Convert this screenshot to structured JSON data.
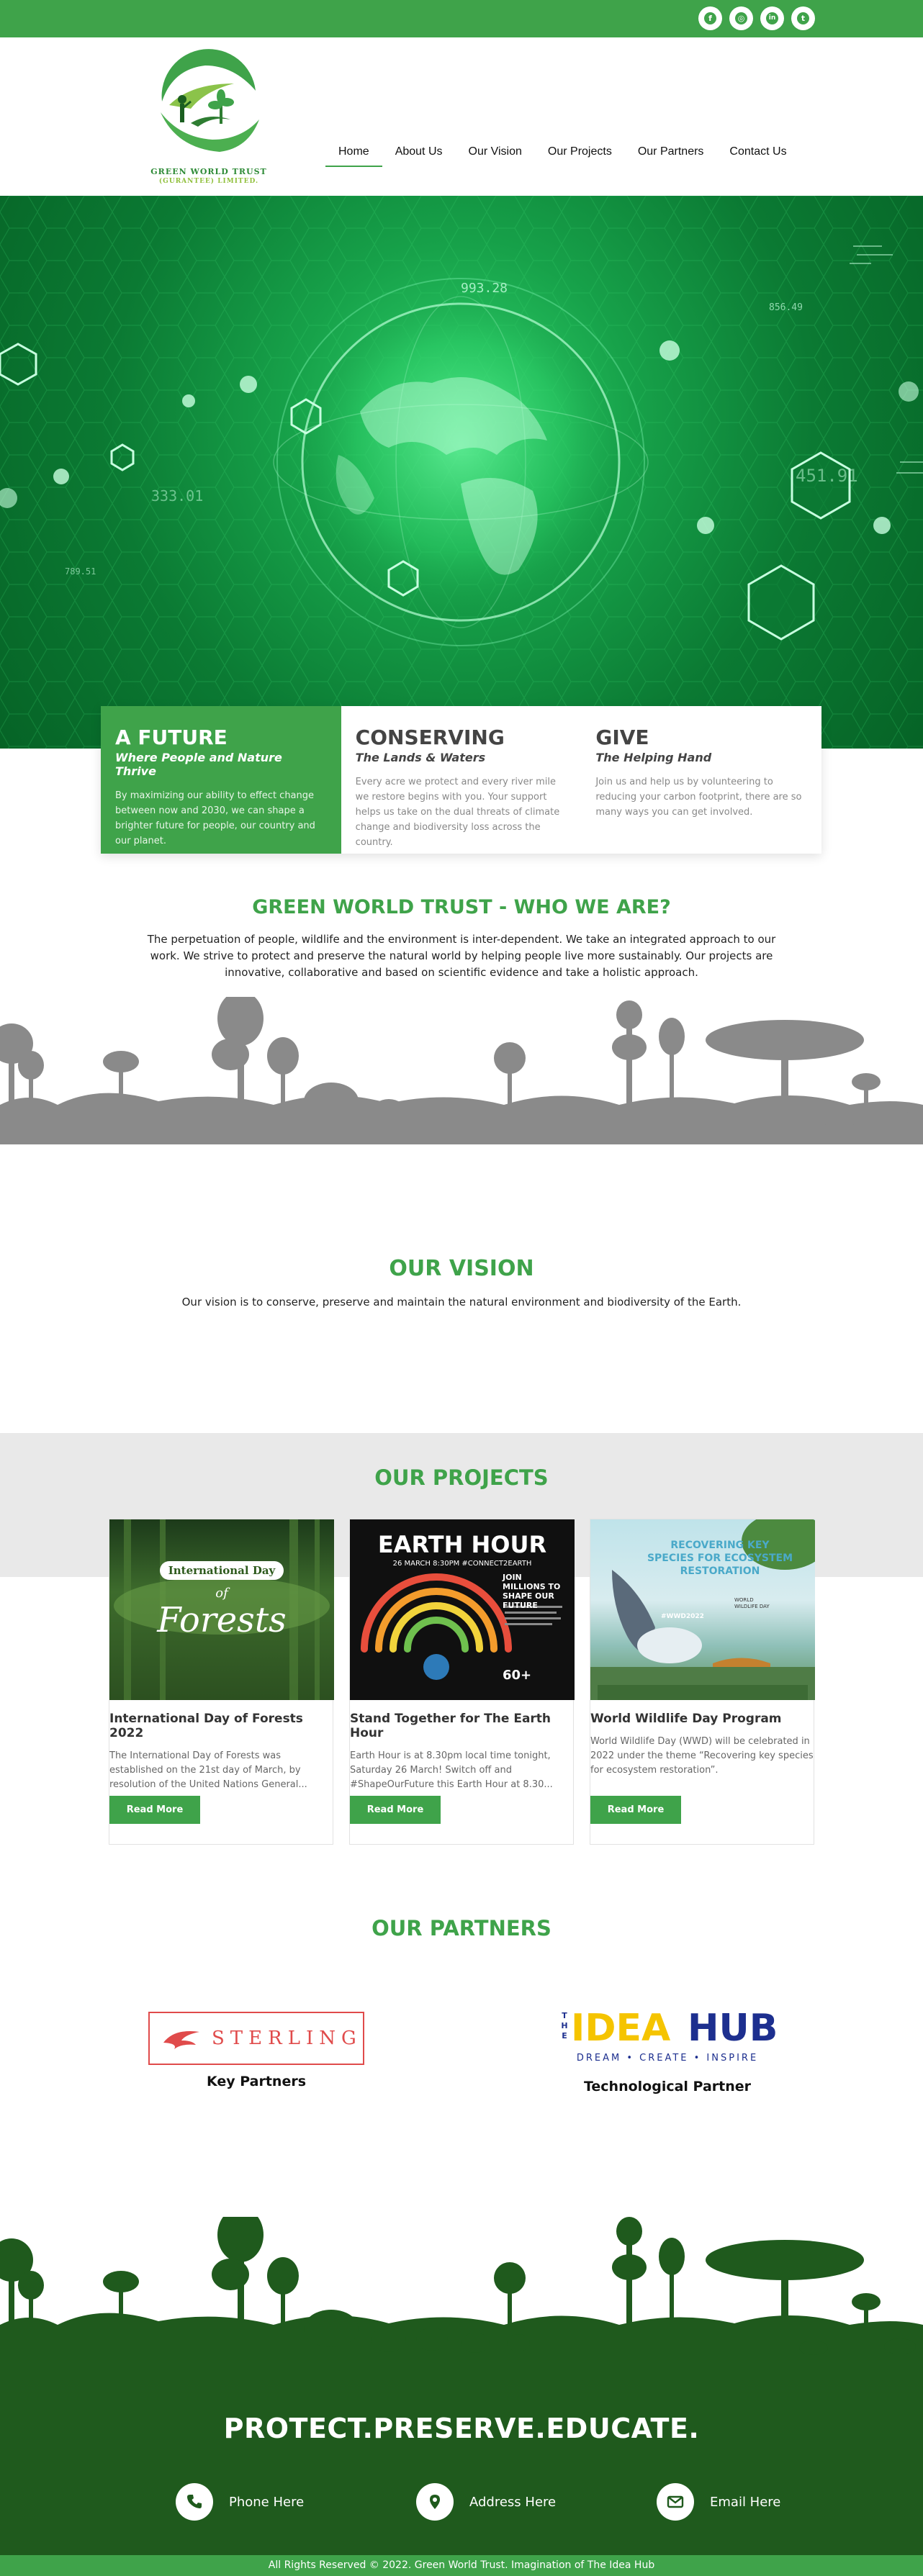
{
  "colors": {
    "brand_green": "#3fa34a",
    "dark_green": "#1f5a1d",
    "light_gray": "#e9e9e9"
  },
  "social": [
    {
      "icon": "facebook-icon",
      "glyph": "f"
    },
    {
      "icon": "instagram-icon",
      "glyph": "◎"
    },
    {
      "icon": "linkedin-icon",
      "glyph": "in"
    },
    {
      "icon": "twitter-icon",
      "glyph": "t"
    }
  ],
  "logo": {
    "line1": "GREEN WORLD TRUST",
    "line2": "(GURANTEE) LIMITED."
  },
  "nav": {
    "items": [
      "Home",
      "About Us",
      "Our Vision",
      "Our Projects",
      "Our Partners",
      "Contact Us"
    ],
    "active": "Home"
  },
  "hero": {
    "numbers": [
      "993.28",
      "856.49",
      "333.01",
      "451.91",
      "789.51"
    ]
  },
  "features": [
    {
      "title": "A FUTURE",
      "subtitle": "Where People and Nature Thrive",
      "text": "By maximizing our ability to effect change between now and 2030, we can shape a brighter future for people, our country and our planet."
    },
    {
      "title": "CONSERVING",
      "subtitle": "The Lands & Waters",
      "text": "Every acre we protect and every river mile we restore begins with you. Your support helps us take on the dual threats of climate change and biodiversity loss across the country."
    },
    {
      "title": "GIVE",
      "subtitle": "The Helping Hand",
      "text": "Join us and help us by volunteering to reducing your carbon footprint, there are so many ways you can get involved."
    }
  ],
  "who": {
    "title": "GREEN WORLD TRUST - WHO WE ARE?",
    "text": "The perpetuation of people, wildlife and the environment is inter-dependent. We take an integrated approach to our work. We strive to protect and preserve the natural world by helping people live more sustainably. Our projects are innovative, collaborative and based on scientific evidence and take a holistic approach."
  },
  "vision": {
    "title": "OUR VISION",
    "text": "Our vision is to conserve, preserve and maintain the natural environment and biodiversity of the Earth."
  },
  "projects": {
    "title": "OUR PROJECTS",
    "button_label": "Read More",
    "cards": [
      {
        "title": "International Day of Forests 2022",
        "text": "The International Day of Forests was established on the 21st day of March, by resolution of the United Nations General...",
        "img_line1": "International Day",
        "img_line2": "of",
        "img_line3": "Forests"
      },
      {
        "title": "Stand Together for The Earth Hour",
        "text": "Earth Hour is at 8.30pm local time tonight, Saturday 26 March! Switch off and #ShapeOurFuture this Earth Hour at 8.30...",
        "img_line1": "EARTH HOUR",
        "img_line2": "26 MARCH 8:30PM #CONNECT2EARTH",
        "img_line3": "JOIN MILLIONS TO SHAPE OUR FUTURE",
        "img_line4": "60+"
      },
      {
        "title": "World Wildlife Day Program",
        "text": "World Wildlife Day (WWD) will be celebrated in 2022 under the theme “Recovering key species for ecosystem restoration”.",
        "img_line1": "RECOVERING KEY",
        "img_line2": "SPECIES FOR ECOSYSTEM",
        "img_line3": "RESTORATION",
        "img_line4": "#WWD2022",
        "img_line5": "WORLD WILDLIFE DAY"
      }
    ]
  },
  "partners": {
    "title": "OUR PARTNERS",
    "items": [
      {
        "logo_text": "STERLING",
        "caption": "Key Partners"
      },
      {
        "logo_the": "THE",
        "logo_idea": "IDEA",
        "logo_hub": "HUB",
        "logo_tagline": "DREAM • CREATE • INSPIRE",
        "caption": "Technological Partner"
      }
    ]
  },
  "footer": {
    "slogan": "PROTECT.PRESERVE.EDUCATE.",
    "contacts": [
      {
        "icon": "phone-icon",
        "label": "Phone Here"
      },
      {
        "icon": "location-icon",
        "label": "Address Here"
      },
      {
        "icon": "email-icon",
        "label": "Email Here"
      }
    ],
    "copyright": "All Rights Reserved © 2022. Green World Trust. Imagination of The Idea Hub"
  }
}
